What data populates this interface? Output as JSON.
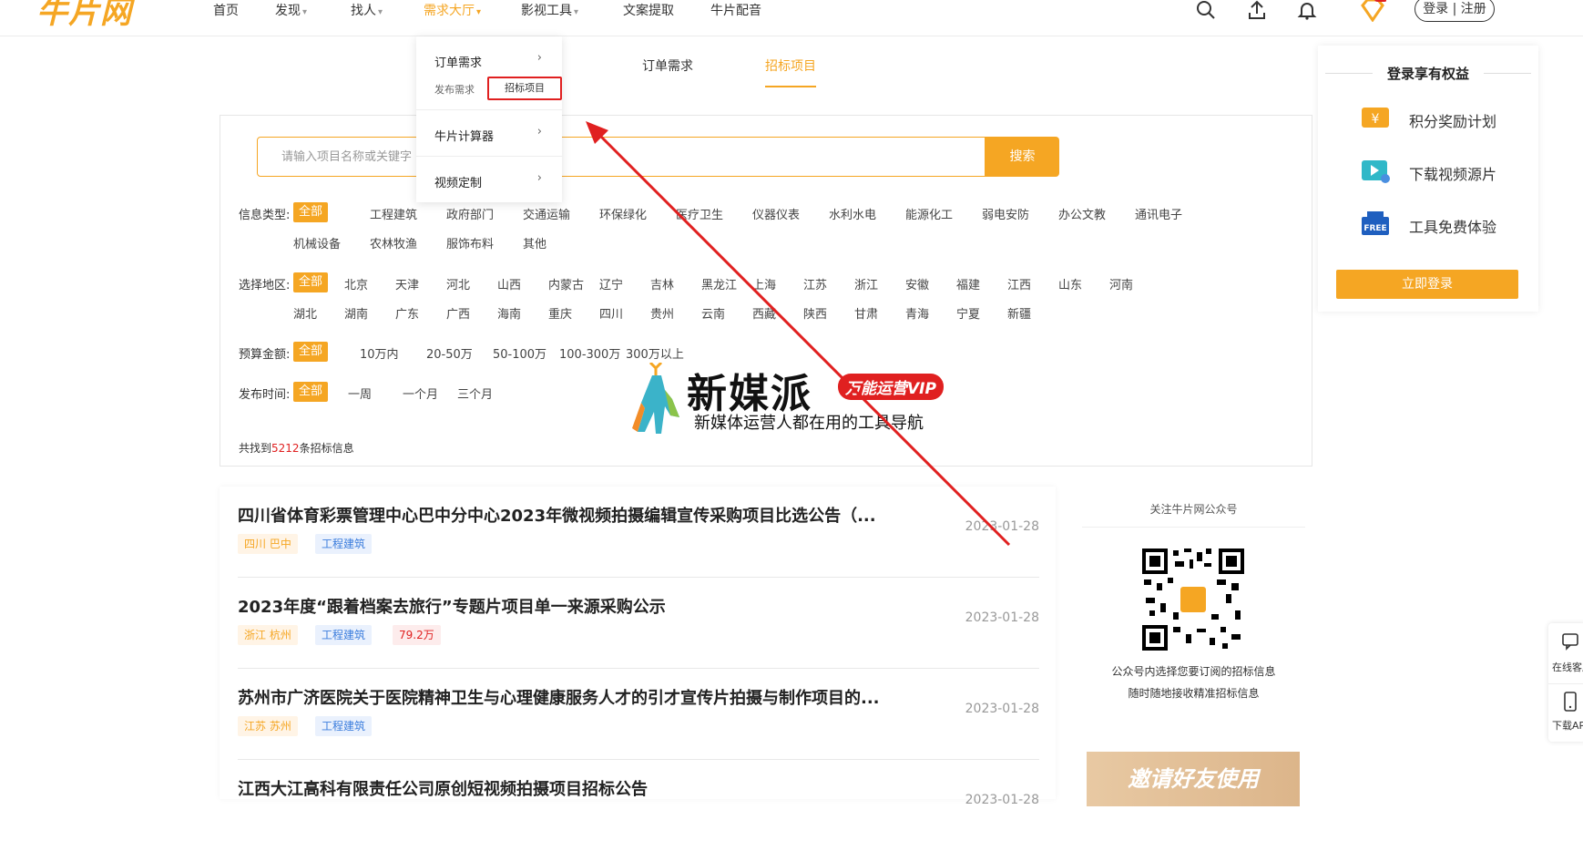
{
  "header": {
    "logo": "牛片网",
    "nav": [
      {
        "label": "首页",
        "has_caret": false
      },
      {
        "label": "发现",
        "has_caret": true
      },
      {
        "label": "找人",
        "has_caret": true
      },
      {
        "label": "需求大厅",
        "has_caret": true,
        "active": true
      },
      {
        "label": "影视工具",
        "has_caret": true
      },
      {
        "label": "文案提取",
        "has_caret": false
      },
      {
        "label": "牛片配音",
        "has_caret": false
      }
    ],
    "login_label": "登录 | 注册"
  },
  "dropdown": {
    "items": [
      {
        "label": "订单需求"
      },
      {
        "label": "牛片计算器"
      },
      {
        "label": "视频定制"
      }
    ],
    "sub_publish": "发布需求",
    "sub_bidding": "招标项目"
  },
  "tabs": {
    "order": "订单需求",
    "bid": "招标项目"
  },
  "search": {
    "placeholder": "请输入项目名称或关键字",
    "button": "搜索"
  },
  "filters": {
    "info_type": {
      "label": "信息类型:",
      "options": [
        "全部",
        "工程建筑",
        "政府部门",
        "交通运输",
        "环保绿化",
        "医疗卫生",
        "仪器仪表",
        "水利水电",
        "能源化工",
        "弱电安防",
        "办公文教",
        "通讯电子",
        "机械设备",
        "农林牧渔",
        "服饰布料",
        "其他"
      ]
    },
    "region": {
      "label": "选择地区:",
      "options": [
        "全部",
        "北京",
        "天津",
        "河北",
        "山西",
        "内蒙古",
        "辽宁",
        "吉林",
        "黑龙江",
        "上海",
        "江苏",
        "浙江",
        "安徽",
        "福建",
        "江西",
        "山东",
        "河南",
        "湖北",
        "湖南",
        "广东",
        "广西",
        "海南",
        "重庆",
        "四川",
        "贵州",
        "云南",
        "西藏",
        "陕西",
        "甘肃",
        "青海",
        "宁夏",
        "新疆"
      ]
    },
    "budget": {
      "label": "预算金额:",
      "options": [
        "全部",
        "10万内",
        "20-50万",
        "50-100万",
        "100-300万",
        "300万以上"
      ]
    },
    "time": {
      "label": "发布时间:",
      "options": [
        "全部",
        "一周",
        "一个月",
        "三个月"
      ]
    },
    "result_prefix": "共找到",
    "result_count": "5212",
    "result_suffix": "条招标信息"
  },
  "watermark": {
    "title": "新媒派",
    "badge": "万能运营VIP",
    "subtitle": "新媒体运营人都在用的工具导航"
  },
  "list": [
    {
      "title": "四川省体育彩票管理中心巴中分中心2023年微视频拍摄编辑宣传采购项目比选公告（...",
      "region": "四川 巴中",
      "category": "工程建筑",
      "budget": "",
      "date": "2023-01-28"
    },
    {
      "title": "2023年度“跟着档案去旅行”专题片项目单一来源采购公示",
      "region": "浙江 杭州",
      "category": "工程建筑",
      "budget": "79.2万",
      "date": "2023-01-28"
    },
    {
      "title": "苏州市广济医院关于医院精神卫生与心理健康服务人才的引才宣传片拍摄与制作项目的...",
      "region": "江苏 苏州",
      "category": "工程建筑",
      "budget": "",
      "date": "2023-01-28"
    },
    {
      "title": "江西大江高科有限责任公司原创短视频拍摄项目招标公告",
      "region": "",
      "category": "",
      "budget": "",
      "date": "2023-01-28"
    }
  ],
  "benefits": {
    "title": "登录享有权益",
    "items": [
      "积分奖励计划",
      "下载视频源片",
      "工具免费体验"
    ],
    "login_now": "立即登录"
  },
  "wechat": {
    "title": "关注牛片网公众号",
    "desc1": "公众号内选择您要订阅的招标信息",
    "desc2": "随时随地接收精准招标信息"
  },
  "invite": "邀请好友使用",
  "float_bar": {
    "service": "在线客服",
    "download": "下载APP"
  },
  "colors": {
    "accent": "#f5a623",
    "highlight_red": "#e02020"
  }
}
